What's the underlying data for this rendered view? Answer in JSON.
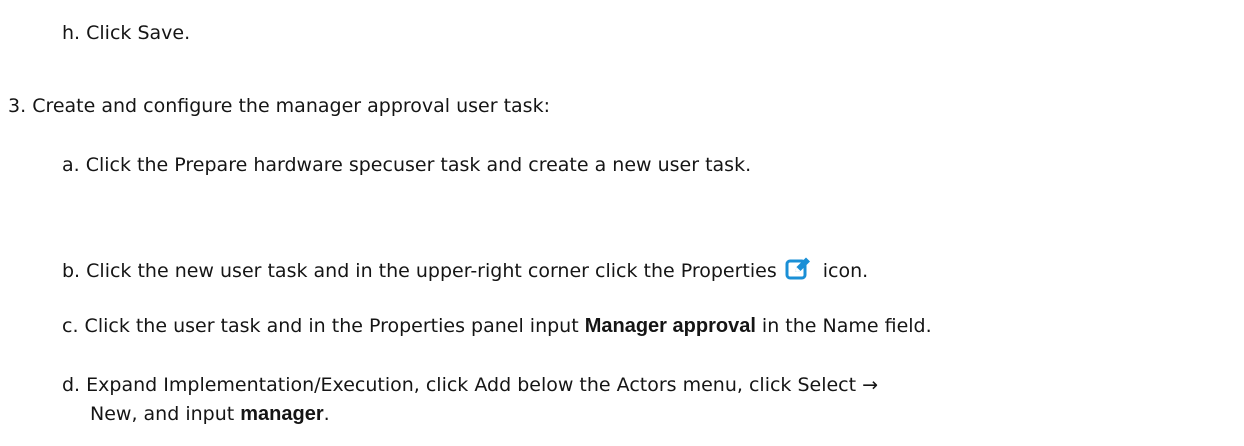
{
  "steps": {
    "h": {
      "marker": "h.",
      "text_before": "Click ",
      "save": "Save",
      "text_after": "."
    },
    "step3": {
      "marker": "3.",
      "text": "Create and configure the manager approval user task:"
    },
    "a": {
      "marker": "a.",
      "text_before": "Click the ",
      "gui": "Prepare hardware spec",
      "text_after": "user task and create a new user task."
    },
    "b": {
      "marker": "b.",
      "text_before": "Click the new user task and in the upper-right corner click the ",
      "gui": "Properties",
      "icon": "edit-properties-icon",
      "text_after": "icon."
    },
    "c": {
      "marker": "c.",
      "text_before": "Click the user task and in the ",
      "gui1": "Properties",
      "text_mid1": " panel input ",
      "strong": "Manager approval",
      "text_mid2": " in the ",
      "gui2": "Name",
      "text_after": " field."
    },
    "d": {
      "marker": "d.",
      "text1": "Expand ",
      "gui1": "Implementation/Execution",
      "text2": ", click ",
      "gui2": "Add",
      "text3": " below the ",
      "gui3": "Actors",
      "text4": " menu, click ",
      "gui4": "Select →",
      "gui5": "New",
      "text5": ", and input ",
      "strong": "manager",
      "text6": "."
    }
  },
  "colors": {
    "icon_blue": "#1a8fd6"
  }
}
